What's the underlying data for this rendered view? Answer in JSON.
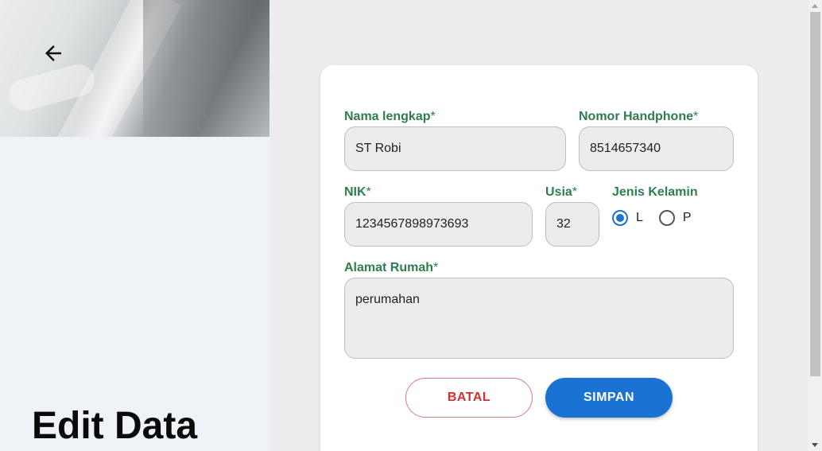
{
  "sidebar": {
    "title": "Edit Data"
  },
  "form": {
    "full_name": {
      "label": "Nama lengkap",
      "required": "*",
      "value": "ST Robi"
    },
    "phone": {
      "label": "Nomor Handphone",
      "required": "*",
      "value": "8514657340"
    },
    "nik": {
      "label": "NIK",
      "required": "*",
      "value": "1234567898973693"
    },
    "age": {
      "label": "Usia",
      "required": "*",
      "value": "32"
    },
    "gender": {
      "label": "Jenis Kelamin",
      "options": [
        "L",
        "P"
      ],
      "selected": "L"
    },
    "address": {
      "label": "Alamat Rumah",
      "required": "*",
      "value": "perumahan"
    }
  },
  "actions": {
    "cancel_label": "BATAL",
    "save_label": "SIMPAN"
  },
  "colors": {
    "label_green": "#2e7d4f",
    "primary_blue": "#1a73d2",
    "cancel_red": "#d32f2f"
  }
}
